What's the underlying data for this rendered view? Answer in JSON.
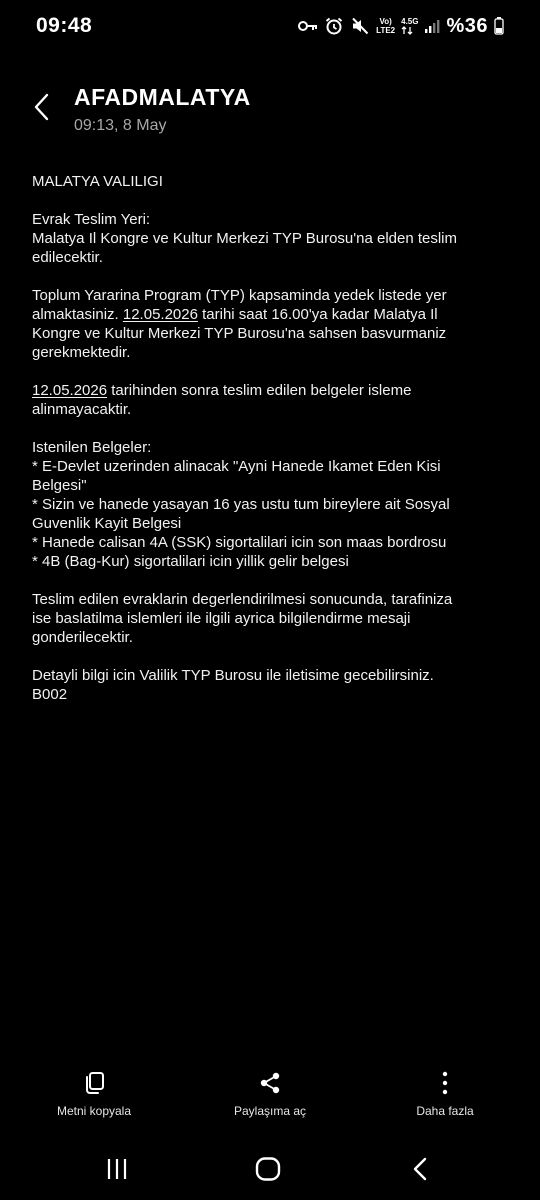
{
  "status_bar": {
    "time": "09:48",
    "net_top": "Vo)",
    "net_bottom": "LTE2",
    "net_type": "4.5G",
    "battery": "%36",
    "icons": [
      "key-icon",
      "alarm-icon",
      "mute-icon",
      "signal-icon",
      "battery-icon"
    ]
  },
  "header": {
    "sender": "AFADMALATYA",
    "timestamp": "09:13, 8 May"
  },
  "message": {
    "p1": "MALATYA VALILIGI",
    "p2_l1": "Evrak Teslim Yeri:",
    "p2_l2": "Malatya Il Kongre ve Kultur Merkezi TYP Burosu'na elden teslim",
    "p2_l3": "edilecektir.",
    "p3_a": "Toplum Yararina Program (TYP) kapsaminda yedek listede yer",
    "p3_b": "almaktasiniz. ",
    "p3_date": "12.05.2026",
    "p3_c": " tarihi saat 16.00'ya kadar Malatya Il",
    "p3_d": "Kongre ve Kultur Merkezi TYP Burosu'na sahsen basvurmaniz",
    "p3_e": "gerekmektedir.",
    "p4_date": "12.05.2026",
    "p4_a": " tarihinden sonra teslim edilen belgeler isleme",
    "p4_b": "alinmayacaktir.",
    "p5_l1": "Istenilen Belgeler:",
    "p5_l2": "* E-Devlet uzerinden alinacak \"Ayni Hanede Ikamet Eden Kisi",
    "p5_l3": "Belgesi\"",
    "p5_l4": "* Sizin ve hanede yasayan 16 yas ustu tum bireylere ait Sosyal",
    "p5_l5": "Guvenlik Kayit Belgesi",
    "p5_l6": "* Hanede calisan 4A (SSK) sigortalilari icin son maas bordrosu",
    "p5_l7": "* 4B (Bag-Kur) sigortalilari icin yillik gelir belgesi",
    "p6_l1": "Teslim edilen evraklarin degerlendirilmesi sonucunda, tarafiniza",
    "p6_l2": "ise baslatilma islemleri ile ilgili ayrica bilgilendirme mesaji",
    "p6_l3": "gonderilecektir.",
    "p7_l1": "Detayli bilgi icin Valilik TYP Burosu ile iletisime gecebilirsiniz.",
    "p7_l2": "B002"
  },
  "actions": {
    "copy_label": "Metni kopyala",
    "share_label": "Paylaşıma aç",
    "more_label": "Daha fazla"
  },
  "nav": {
    "icons": [
      "recent-apps-icon",
      "home-icon",
      "back-icon"
    ]
  },
  "colors": {
    "background": "#000000",
    "text": "#f2f2f2",
    "secondary_text": "#a8a8a8"
  }
}
